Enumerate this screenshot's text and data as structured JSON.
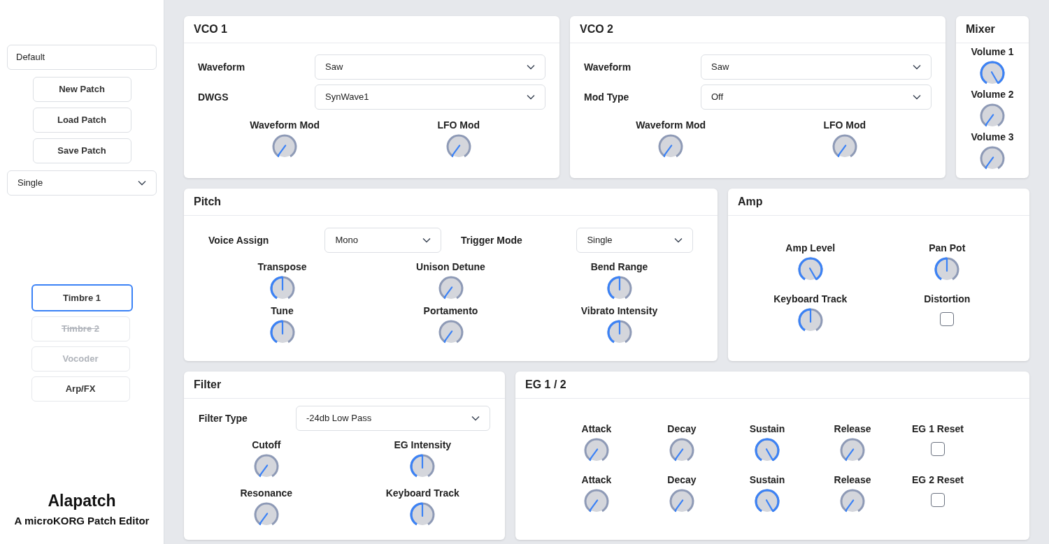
{
  "sidebar": {
    "patch_name_field": {
      "value": "Default"
    },
    "buttons": [
      "New Patch",
      "Load Patch",
      "Save Patch"
    ],
    "mode_select": {
      "value": "Single"
    },
    "timbre_tabs": [
      {
        "label": "Timbre 1",
        "selected": true,
        "disabled": false,
        "struck": false
      },
      {
        "label": "Timbre 2",
        "selected": false,
        "disabled": true,
        "struck": true
      },
      {
        "label": "Vocoder",
        "selected": false,
        "disabled": true,
        "struck": false
      },
      {
        "label": "Arp/FX",
        "selected": false,
        "disabled": false,
        "struck": false
      }
    ],
    "app_title": "Alapatch",
    "app_subtitle": "A microKORG Patch Editor"
  },
  "vco1": {
    "title": "VCO 1",
    "selects": [
      {
        "label": "Waveform",
        "value": "Saw"
      },
      {
        "label": "DWGS",
        "value": "SynWave1"
      }
    ],
    "knobs": [
      {
        "label": "Waveform Mod",
        "level": 0.02
      },
      {
        "label": "LFO Mod",
        "level": 0.02
      }
    ]
  },
  "vco2": {
    "title": "VCO 2",
    "selects": [
      {
        "label": "Waveform",
        "value": "Saw"
      },
      {
        "label": "Mod Type",
        "value": "Off"
      }
    ],
    "knobs": [
      {
        "label": "Waveform Mod",
        "level": 0.02
      },
      {
        "label": "LFO Mod",
        "level": 0.02
      }
    ]
  },
  "mixer": {
    "title": "Mixer",
    "knobs": [
      {
        "label": "Volume 1",
        "level": 1
      },
      {
        "label": "Volume 2",
        "level": 0.02
      },
      {
        "label": "Volume 3",
        "level": 0.02
      }
    ]
  },
  "pitch": {
    "title": "Pitch",
    "selects": [
      {
        "label": "Voice Assign",
        "value": "Mono"
      },
      {
        "label": "Trigger Mode",
        "value": "Single"
      }
    ],
    "knobs": [
      {
        "label": "Transpose",
        "level": 0.5
      },
      {
        "label": "Unison Detune",
        "level": 0.02
      },
      {
        "label": "Bend Range",
        "level": 0.5
      },
      {
        "label": "Tune",
        "level": 0.5
      },
      {
        "label": "Portamento",
        "level": 0.02
      },
      {
        "label": "Vibrato Intensity",
        "level": 0.5
      }
    ]
  },
  "amp": {
    "title": "Amp",
    "controls": [
      {
        "kind": "knob",
        "label": "Amp Level",
        "level": 1
      },
      {
        "kind": "knob",
        "label": "Pan Pot",
        "level": 0.5
      },
      {
        "kind": "knob",
        "label": "Keyboard Track",
        "level": 0.5
      },
      {
        "kind": "checkbox",
        "label": "Distortion",
        "checked": false
      }
    ]
  },
  "filter": {
    "title": "Filter",
    "selects": [
      {
        "label": "Filter Type",
        "value": "-24db Low Pass"
      }
    ],
    "knobs": [
      {
        "label": "Cutoff",
        "level": 0.02
      },
      {
        "label": "EG Intensity",
        "level": 0.5
      },
      {
        "label": "Resonance",
        "level": 0.02
      },
      {
        "label": "Keyboard Track",
        "level": 0.5
      }
    ]
  },
  "eg": {
    "title": "EG 1 / 2",
    "rows": [
      [
        {
          "kind": "knob",
          "label": "Attack",
          "level": 0.02
        },
        {
          "kind": "knob",
          "label": "Decay",
          "level": 0.02
        },
        {
          "kind": "knob",
          "label": "Sustain",
          "level": 1
        },
        {
          "kind": "knob",
          "label": "Release",
          "level": 0.02
        },
        {
          "kind": "checkbox",
          "label": "EG 1 Reset",
          "checked": false
        }
      ],
      [
        {
          "kind": "knob",
          "label": "Attack",
          "level": 0.02
        },
        {
          "kind": "knob",
          "label": "Decay",
          "level": 0.02
        },
        {
          "kind": "knob",
          "label": "Sustain",
          "level": 1
        },
        {
          "kind": "knob",
          "label": "Release",
          "level": 0.02
        },
        {
          "kind": "checkbox",
          "label": "EG 2 Reset",
          "checked": false
        }
      ]
    ]
  }
}
